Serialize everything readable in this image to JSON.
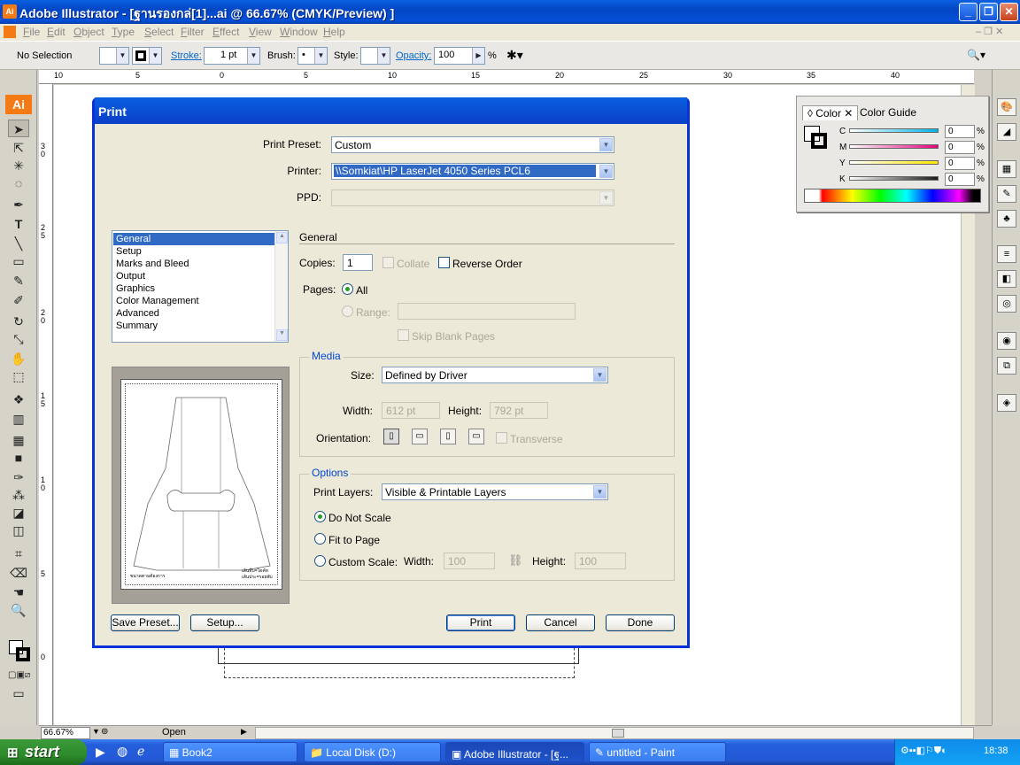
{
  "window": {
    "app_icon": "Ai",
    "title": "Adobe Illustrator - [ฐานรองกล่[1]...ai @ 66.67% (CMYK/Preview) ]"
  },
  "menu": [
    "File",
    "Edit",
    "Object",
    "Type",
    "Select",
    "Filter",
    "Effect",
    "View",
    "Window",
    "Help"
  ],
  "control": {
    "selection": "No Selection",
    "stroke_label": "Stroke:",
    "stroke_value": "1 pt",
    "brush_label": "Brush:",
    "brush_value": "•",
    "style_label": "Style:",
    "opacity_label": "Opacity:",
    "opacity_value": "100",
    "opacity_unit": "%"
  },
  "ruler": {
    "h": [
      "10",
      "5",
      "0",
      "5",
      "10",
      "15",
      "20",
      "25",
      "30",
      "35",
      "40"
    ],
    "v": [
      "3\n0",
      "2\n5",
      "2\n0",
      "1\n5",
      "1\n0",
      "5",
      "0"
    ]
  },
  "color_panel": {
    "tabs": [
      "Color",
      "Color Guide"
    ],
    "channels": [
      {
        "name": "C",
        "value": "0",
        "color": "#00b3e6"
      },
      {
        "name": "M",
        "value": "0",
        "color": "#e6007e"
      },
      {
        "name": "Y",
        "value": "0",
        "color": "#ffe600"
      },
      {
        "name": "K",
        "value": "0",
        "color": "#1a1a1a"
      }
    ],
    "unit": "%"
  },
  "dialog": {
    "title": "Print",
    "print_preset_label": "Print Preset:",
    "print_preset": "Custom",
    "printer_label": "Printer:",
    "printer": "\\\\Somkiat\\HP LaserJet 4050 Series PCL6",
    "ppd_label": "PPD:",
    "categories": [
      "General",
      "Setup",
      "Marks and Bleed",
      "Output",
      "Graphics",
      "Color Management",
      "Advanced",
      "Summary"
    ],
    "section": "General",
    "copies_label": "Copies:",
    "copies": "1",
    "collate": "Collate",
    "reverse_order": "Reverse Order",
    "pages_label": "Pages:",
    "all": "All",
    "range": "Range:",
    "skip_blank": "Skip Blank Pages",
    "media_title": "Media",
    "size_label": "Size:",
    "size": "Defined by Driver",
    "width_label": "Width:",
    "width": "612 pt",
    "height_label": "Height:",
    "height": "792 pt",
    "orientation_label": "Orientation:",
    "transverse": "Transverse",
    "options_title": "Options",
    "print_layers_label": "Print Layers:",
    "print_layers": "Visible & Printable Layers",
    "do_not_scale": "Do Not Scale",
    "fit_to_page": "Fit to Page",
    "custom_scale": "Custom Scale:",
    "cs_width_label": "Width:",
    "cs_width": "100",
    "cs_height_label": "Height:",
    "cs_height": "100",
    "preview_text_left": "ขนาดตามต้องการ",
    "preview_text_right_1": "เส้นทึบ=ไดคัท",
    "preview_text_right_2": "เส้นประ=รอยพับ",
    "save_preset": "Save Preset...",
    "setup": "Setup...",
    "print": "Print",
    "cancel": "Cancel",
    "done": "Done"
  },
  "status": {
    "zoom": "66.67%",
    "state": "Open"
  },
  "taskbar": {
    "start": "start",
    "tasks": [
      "Book2",
      "Local Disk (D:)",
      "Adobe Illustrator - [ฐ...",
      "untitled - Paint"
    ],
    "clock": "18:38"
  }
}
